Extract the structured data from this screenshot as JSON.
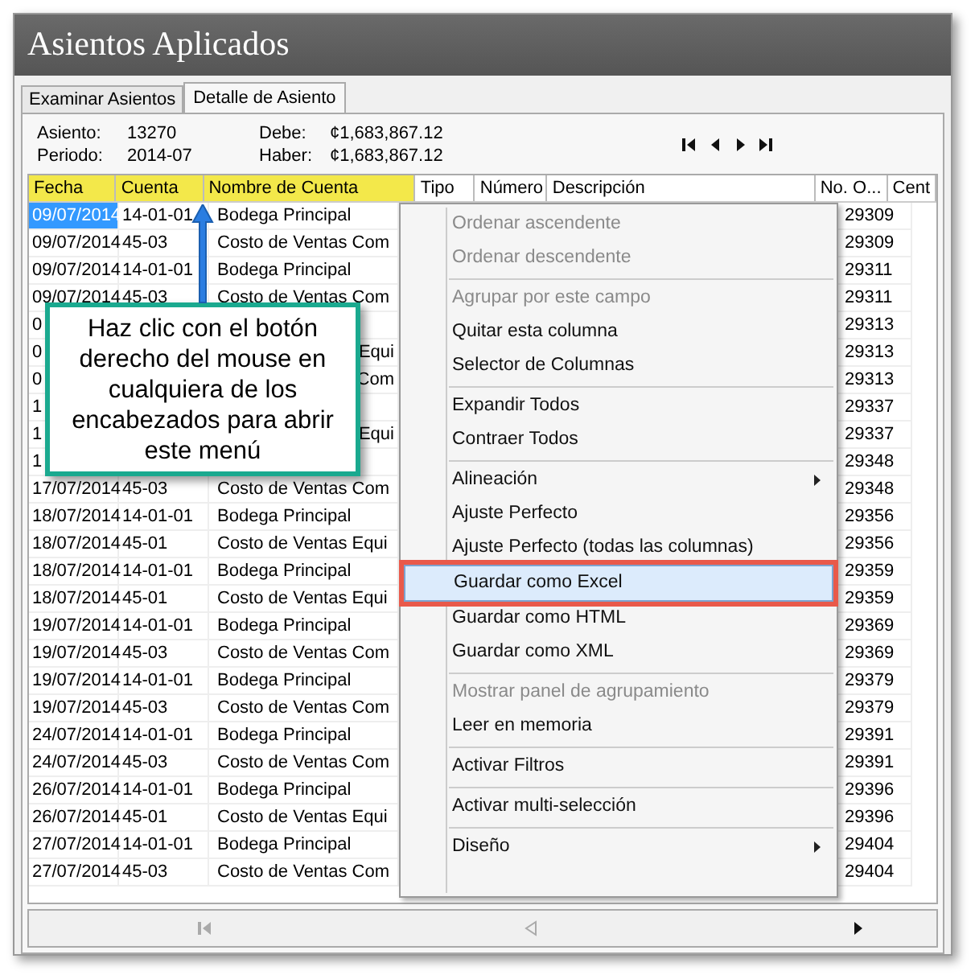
{
  "window": {
    "title": "Asientos Aplicados"
  },
  "tabs": [
    {
      "label": "Examinar Asientos",
      "selected": false
    },
    {
      "label": "Detalle de Asiento",
      "selected": true
    }
  ],
  "info": {
    "fields": [
      {
        "label": "Asiento:",
        "value": "13270"
      },
      {
        "label": "Periodo:",
        "value": "2014-07"
      },
      {
        "label": "Debe:",
        "value": "¢1,683,867.12"
      },
      {
        "label": "Haber:",
        "value": "¢1,683,867.12"
      }
    ],
    "nav": [
      {
        "kind": "first"
      },
      {
        "kind": "prev"
      },
      {
        "kind": "next"
      },
      {
        "kind": "last"
      }
    ]
  },
  "grid": {
    "columns": [
      {
        "label": "Fecha",
        "highlighted": true
      },
      {
        "label": "Cuenta",
        "highlighted": true
      },
      {
        "label": "Nombre de Cuenta",
        "highlighted": true
      },
      {
        "label": "Tipo",
        "highlighted": false
      },
      {
        "label": "Número",
        "highlighted": false
      },
      {
        "label": "Descripción",
        "highlighted": false
      },
      {
        "label": "No. O...",
        "highlighted": false
      },
      {
        "label": "Cent",
        "highlighted": false
      }
    ],
    "rows": [
      {
        "kind": "full",
        "fecha": "09/07/2014",
        "cuenta": "14-01-01",
        "nombre": "Bodega Principal",
        "no_o": "29309",
        "selected": true
      },
      {
        "kind": "full",
        "fecha": "09/07/2014",
        "cuenta": "45-03",
        "nombre": "Costo de Ventas Com",
        "no_o": "29309",
        "selected": false
      },
      {
        "kind": "full",
        "fecha": "09/07/2014",
        "cuenta": "14-01-01",
        "nombre": "Bodega Principal",
        "no_o": "29311",
        "selected": false
      },
      {
        "kind": "full",
        "fecha": "09/07/2014",
        "cuenta": "45-03",
        "nombre": "Costo de Ventas Com",
        "no_o": "29311",
        "selected": false
      },
      {
        "kind": "covered",
        "fecha": "0",
        "no_o": "29313",
        "selected": false
      },
      {
        "kind": "covered",
        "fecha": "0",
        "nombre": "Equi",
        "no_o": "29313",
        "selected": false
      },
      {
        "kind": "covered",
        "fecha": "0",
        "nombre": "Com",
        "no_o": "29313",
        "selected": false
      },
      {
        "kind": "covered",
        "fecha": "1",
        "no_o": "29337",
        "selected": false
      },
      {
        "kind": "covered",
        "fecha": "1",
        "nombre": "Equi",
        "no_o": "29337",
        "selected": false
      },
      {
        "kind": "covered",
        "fecha": "1",
        "no_o": "29348",
        "selected": false
      },
      {
        "kind": "full",
        "fecha": "17/07/2014",
        "cuenta": "45-03",
        "nombre": "Costo de Ventas Com",
        "no_o": "29348",
        "selected": false
      },
      {
        "kind": "full",
        "fecha": "18/07/2014",
        "cuenta": "14-01-01",
        "nombre": "Bodega Principal",
        "no_o": "29356",
        "selected": false
      },
      {
        "kind": "full",
        "fecha": "18/07/2014",
        "cuenta": "45-01",
        "nombre": "Costo de Ventas Equi",
        "no_o": "29356",
        "selected": false
      },
      {
        "kind": "full",
        "fecha": "18/07/2014",
        "cuenta": "14-01-01",
        "nombre": "Bodega Principal",
        "no_o": "29359",
        "selected": false
      },
      {
        "kind": "full",
        "fecha": "18/07/2014",
        "cuenta": "45-01",
        "nombre": "Costo de Ventas Equi",
        "no_o": "29359",
        "selected": false
      },
      {
        "kind": "full",
        "fecha": "19/07/2014",
        "cuenta": "14-01-01",
        "nombre": "Bodega Principal",
        "no_o": "29369",
        "selected": false
      },
      {
        "kind": "full",
        "fecha": "19/07/2014",
        "cuenta": "45-03",
        "nombre": "Costo de Ventas Com",
        "no_o": "29369",
        "selected": false
      },
      {
        "kind": "full",
        "fecha": "19/07/2014",
        "cuenta": "14-01-01",
        "nombre": "Bodega Principal",
        "no_o": "29379",
        "selected": false
      },
      {
        "kind": "full",
        "fecha": "19/07/2014",
        "cuenta": "45-03",
        "nombre": "Costo de Ventas Com",
        "no_o": "29379",
        "selected": false
      },
      {
        "kind": "full",
        "fecha": "24/07/2014",
        "cuenta": "14-01-01",
        "nombre": "Bodega Principal",
        "no_o": "29391",
        "selected": false
      },
      {
        "kind": "full",
        "fecha": "24/07/2014",
        "cuenta": "45-03",
        "nombre": "Costo de Ventas Com",
        "no_o": "29391",
        "selected": false
      },
      {
        "kind": "full",
        "fecha": "26/07/2014",
        "cuenta": "14-01-01",
        "nombre": "Bodega Principal",
        "no_o": "29396",
        "selected": false
      },
      {
        "kind": "full",
        "fecha": "26/07/2014",
        "cuenta": "45-01",
        "nombre": "Costo de Ventas Equi",
        "no_o": "29396",
        "selected": false
      },
      {
        "kind": "full",
        "fecha": "27/07/2014",
        "cuenta": "14-01-01",
        "nombre": "Bodega Principal",
        "no_o": "29404",
        "selected": false
      },
      {
        "kind": "full",
        "fecha": "27/07/2014",
        "cuenta": "45-03",
        "nombre": "Costo de Ventas Com",
        "no_o": "29404",
        "selected": false
      }
    ]
  },
  "context_menu": {
    "groups": [
      [
        {
          "label": "Ordenar ascendente",
          "disabled": true,
          "submenu": false,
          "selected": false
        },
        {
          "label": "Ordenar descendente",
          "disabled": true,
          "submenu": false,
          "selected": false
        }
      ],
      [
        {
          "label": "Agrupar por este campo",
          "disabled": true,
          "submenu": false,
          "selected": false
        },
        {
          "label": "Quitar esta columna",
          "disabled": false,
          "submenu": false,
          "selected": false
        },
        {
          "label": "Selector de Columnas",
          "disabled": false,
          "submenu": false,
          "selected": false
        }
      ],
      [
        {
          "label": "Expandir Todos",
          "disabled": false,
          "submenu": false,
          "selected": false
        },
        {
          "label": "Contraer Todos",
          "disabled": false,
          "submenu": false,
          "selected": false
        }
      ],
      [
        {
          "label": "Alineación",
          "disabled": false,
          "submenu": true,
          "selected": false
        },
        {
          "label": "Ajuste Perfecto",
          "disabled": false,
          "submenu": false,
          "selected": false
        },
        {
          "label": "Ajuste Perfecto (todas las columnas)",
          "disabled": false,
          "submenu": false,
          "selected": false
        },
        {
          "label": "Guardar como Excel",
          "disabled": false,
          "submenu": false,
          "selected": true
        },
        {
          "label": "Guardar como HTML",
          "disabled": false,
          "submenu": false,
          "selected": false
        },
        {
          "label": "Guardar como XML",
          "disabled": false,
          "submenu": false,
          "selected": false
        }
      ],
      [
        {
          "label": "Mostrar panel de agrupamiento",
          "disabled": true,
          "submenu": false,
          "selected": false
        },
        {
          "label": "Leer en memoria",
          "disabled": false,
          "submenu": false,
          "selected": false
        }
      ],
      [
        {
          "label": "Activar Filtros",
          "disabled": false,
          "submenu": false,
          "selected": false
        }
      ],
      [
        {
          "label": "Activar multi-selección",
          "disabled": false,
          "submenu": false,
          "selected": false
        }
      ],
      [
        {
          "label": "Diseño",
          "disabled": false,
          "submenu": true,
          "selected": false
        }
      ]
    ]
  },
  "callout": {
    "text": "Haz clic con el botón derecho del mouse en cualquiera de los encabezados para abrir este menú"
  },
  "bottom_nav": [
    {
      "kind": "first",
      "disabled": true
    },
    {
      "kind": "left",
      "disabled": true
    },
    {
      "kind": "right",
      "disabled": false
    }
  ]
}
